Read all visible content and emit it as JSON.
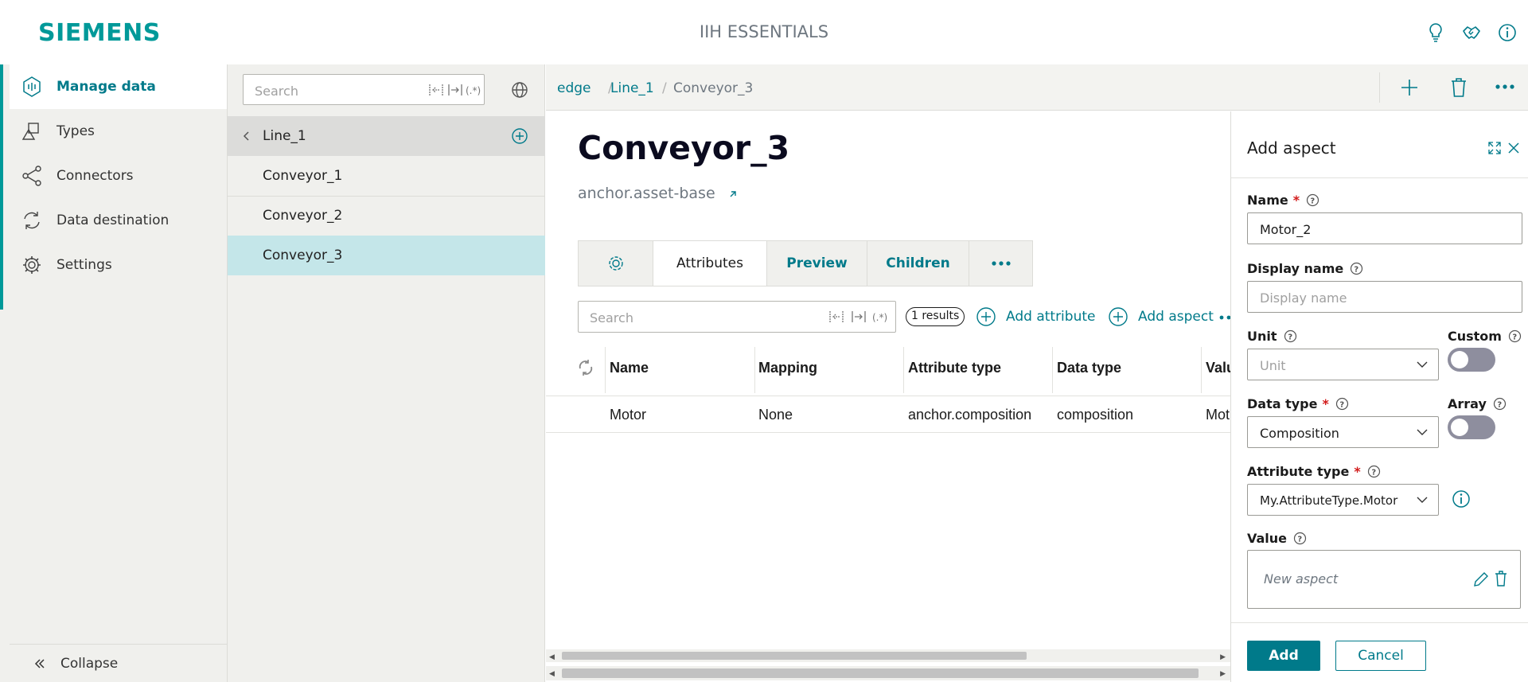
{
  "header": {
    "brand": "SIEMENS",
    "app_title": "IIH ESSENTIALS",
    "icons": [
      "lightbulb-icon",
      "handshake-icon",
      "info-icon"
    ]
  },
  "nav": {
    "items": [
      {
        "label": "Manage data",
        "icon": "manage-data-icon",
        "active": true
      },
      {
        "label": "Types",
        "icon": "types-icon"
      },
      {
        "label": "Connectors",
        "icon": "connectors-icon"
      },
      {
        "label": "Data destination",
        "icon": "data-destination-icon"
      },
      {
        "label": "Settings",
        "icon": "settings-gear-icon"
      }
    ],
    "collapse_label": "Collapse"
  },
  "tree": {
    "search_placeholder": "Search",
    "parent": "Line_1",
    "children": [
      "Conveyor_1",
      "Conveyor_2",
      "Conveyor_3"
    ],
    "selected": "Conveyor_3"
  },
  "breadcrumb": {
    "items": [
      "edge",
      "Line_1",
      "Conveyor_3"
    ]
  },
  "asset": {
    "title": "Conveyor_3",
    "type": "anchor.asset-base"
  },
  "tabs": {
    "attributes": "Attributes",
    "preview": "Preview",
    "children": "Children"
  },
  "attributes": {
    "search_placeholder": "Search",
    "results": "1 results",
    "add_attribute": "Add attribute",
    "add_aspect": "Add aspect",
    "columns": [
      "Name",
      "Mapping",
      "Attribute type",
      "Data type",
      "Valu"
    ],
    "rows": [
      {
        "name": "Motor",
        "mapping": "None",
        "attribute_type": "anchor.composition",
        "data_type": "composition",
        "value": "Mot"
      }
    ]
  },
  "panel": {
    "title": "Add aspect",
    "name_label": "Name",
    "name_value": "Motor_2",
    "display_name_label": "Display name",
    "display_name_placeholder": "Display name",
    "unit_label": "Unit",
    "unit_placeholder": "Unit",
    "custom_label": "Custom",
    "data_type_label": "Data type",
    "data_type_value": "Composition",
    "array_label": "Array",
    "attribute_type_label": "Attribute type",
    "attribute_type_value": "My.AttributeType.Motor",
    "value_label": "Value",
    "value_placeholder": "New aspect",
    "add_button": "Add",
    "cancel_button": "Cancel",
    "required_mark": "*"
  },
  "colors": {
    "accent": "#009999",
    "link": "#007a8a",
    "selected_row": "#c4e6e9",
    "toggle_off": "#8e8e9e"
  }
}
